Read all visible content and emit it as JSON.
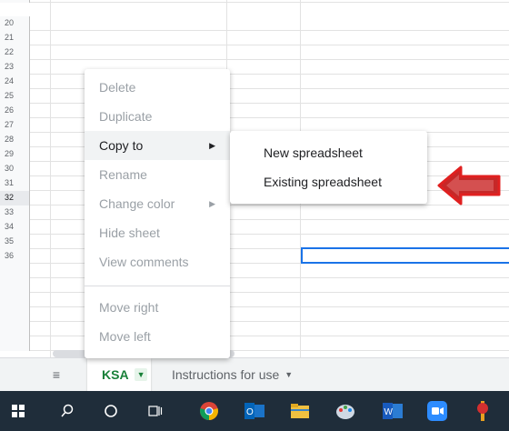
{
  "rows": [
    "20",
    "21",
    "22",
    "23",
    "24",
    "25",
    "26",
    "27",
    "28",
    "29",
    "30",
    "31",
    "32",
    "33",
    "34",
    "35",
    "36"
  ],
  "selected_row": "32",
  "context_menu": {
    "items": [
      {
        "label": "Delete",
        "enabled": false
      },
      {
        "label": "Duplicate",
        "enabled": false
      },
      {
        "label": "Copy to",
        "enabled": true,
        "submenu": true
      },
      {
        "label": "Rename",
        "enabled": false
      },
      {
        "label": "Change color",
        "enabled": false,
        "submenu": true
      },
      {
        "label": "Hide sheet",
        "enabled": false
      },
      {
        "label": "View comments",
        "enabled": false
      },
      {
        "label": "Move right",
        "enabled": false
      },
      {
        "label": "Move left",
        "enabled": false
      }
    ]
  },
  "copy_to_submenu": {
    "items": [
      "New spreadsheet",
      "Existing spreadsheet"
    ]
  },
  "sheet_tabs": [
    {
      "label": "KSA",
      "active": true
    },
    {
      "label": "Instructions for use",
      "active": false
    }
  ],
  "taskbar": {
    "icons": [
      "windows-start-icon",
      "search-icon",
      "cortana-icon",
      "task-view-icon",
      "chrome-icon",
      "outlook-icon",
      "file-explorer-icon",
      "paint-icon",
      "word-icon",
      "zoom-icon",
      "app-icon"
    ]
  },
  "colors": {
    "accent": "#188038",
    "selection": "#1a73e8",
    "annotation_arrow": "#e02020"
  }
}
